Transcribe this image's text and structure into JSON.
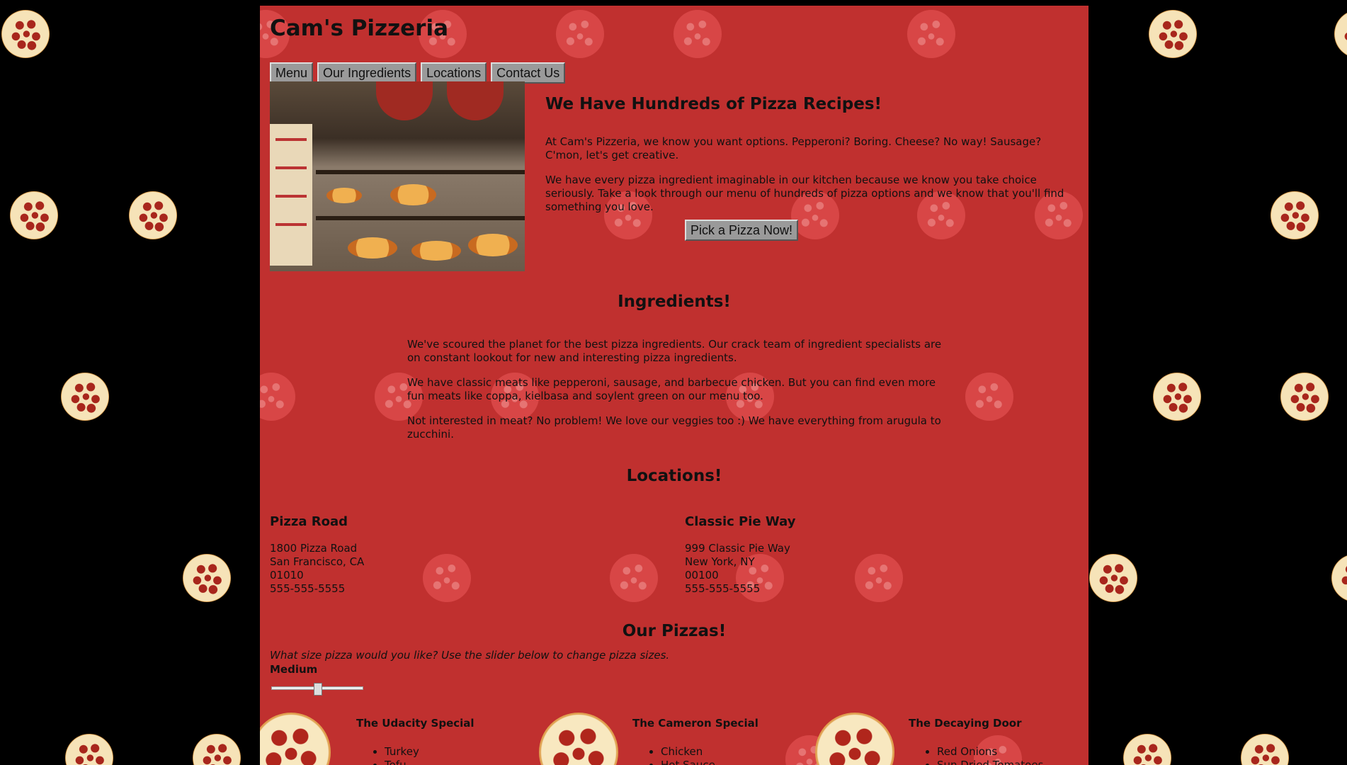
{
  "site": {
    "title": "Cam's Pizzeria",
    "colors": {
      "background": "#000000",
      "panel": "#c0302f",
      "button": "#9a9a9a"
    }
  },
  "nav": [
    "Menu",
    "Our Ingredients",
    "Locations",
    "Contact Us"
  ],
  "hero": {
    "image_icon": "pizzeria-counter-photo",
    "heading": "We Have Hundreds of Pizza Recipes!",
    "p1": "At Cam's Pizzeria, we know you want options. Pepperoni? Boring. Cheese? No way! Sausage? C'mon, let's get creative.",
    "p2": "We have every pizza ingredient imaginable in our kitchen because we know you take choice seriously. Take a look through our menu of hundreds of pizza options and we know that you'll find something you love.",
    "button": "Pick a Pizza Now!"
  },
  "ingredients": {
    "heading": "Ingredients!",
    "p1": "We've scoured the planet for the best pizza ingredients. Our crack team of ingredient specialists are on constant lookout for new and interesting pizza ingredients.",
    "p2": "We have classic meats like pepperoni, sausage, and barbecue chicken. But you can find even more fun meats like coppa, kielbasa and soylent green on our menu too.",
    "p3": "Not interested in meat? No problem! We love our veggies too :) We have everything from arugula to zucchini."
  },
  "locations": {
    "heading": "Locations!",
    "items": [
      {
        "name": "Pizza Road",
        "street": "1800 Pizza Road",
        "city": "San Francisco, CA",
        "zip": "01010",
        "phone": "555-555-5555"
      },
      {
        "name": "Classic Pie Way",
        "street": "999 Classic Pie Way",
        "city": "New York, NY",
        "zip": "00100",
        "phone": "555-555-5555"
      }
    ]
  },
  "pizzas": {
    "heading": "Our Pizzas!",
    "prompt": "What size pizza would you like? Use the slider below to change pizza sizes.",
    "size_label": "Medium",
    "slider_value": 0.5,
    "items": [
      {
        "name": "The Udacity Special",
        "ingredients": [
          "Turkey",
          "Tofu"
        ]
      },
      {
        "name": "The Cameron Special",
        "ingredients": [
          "Chicken",
          "Hot Sauce"
        ]
      },
      {
        "name": "The Decaying Door",
        "ingredients": [
          "Red Onions",
          "Sun Dried Tomatoes"
        ]
      }
    ]
  }
}
